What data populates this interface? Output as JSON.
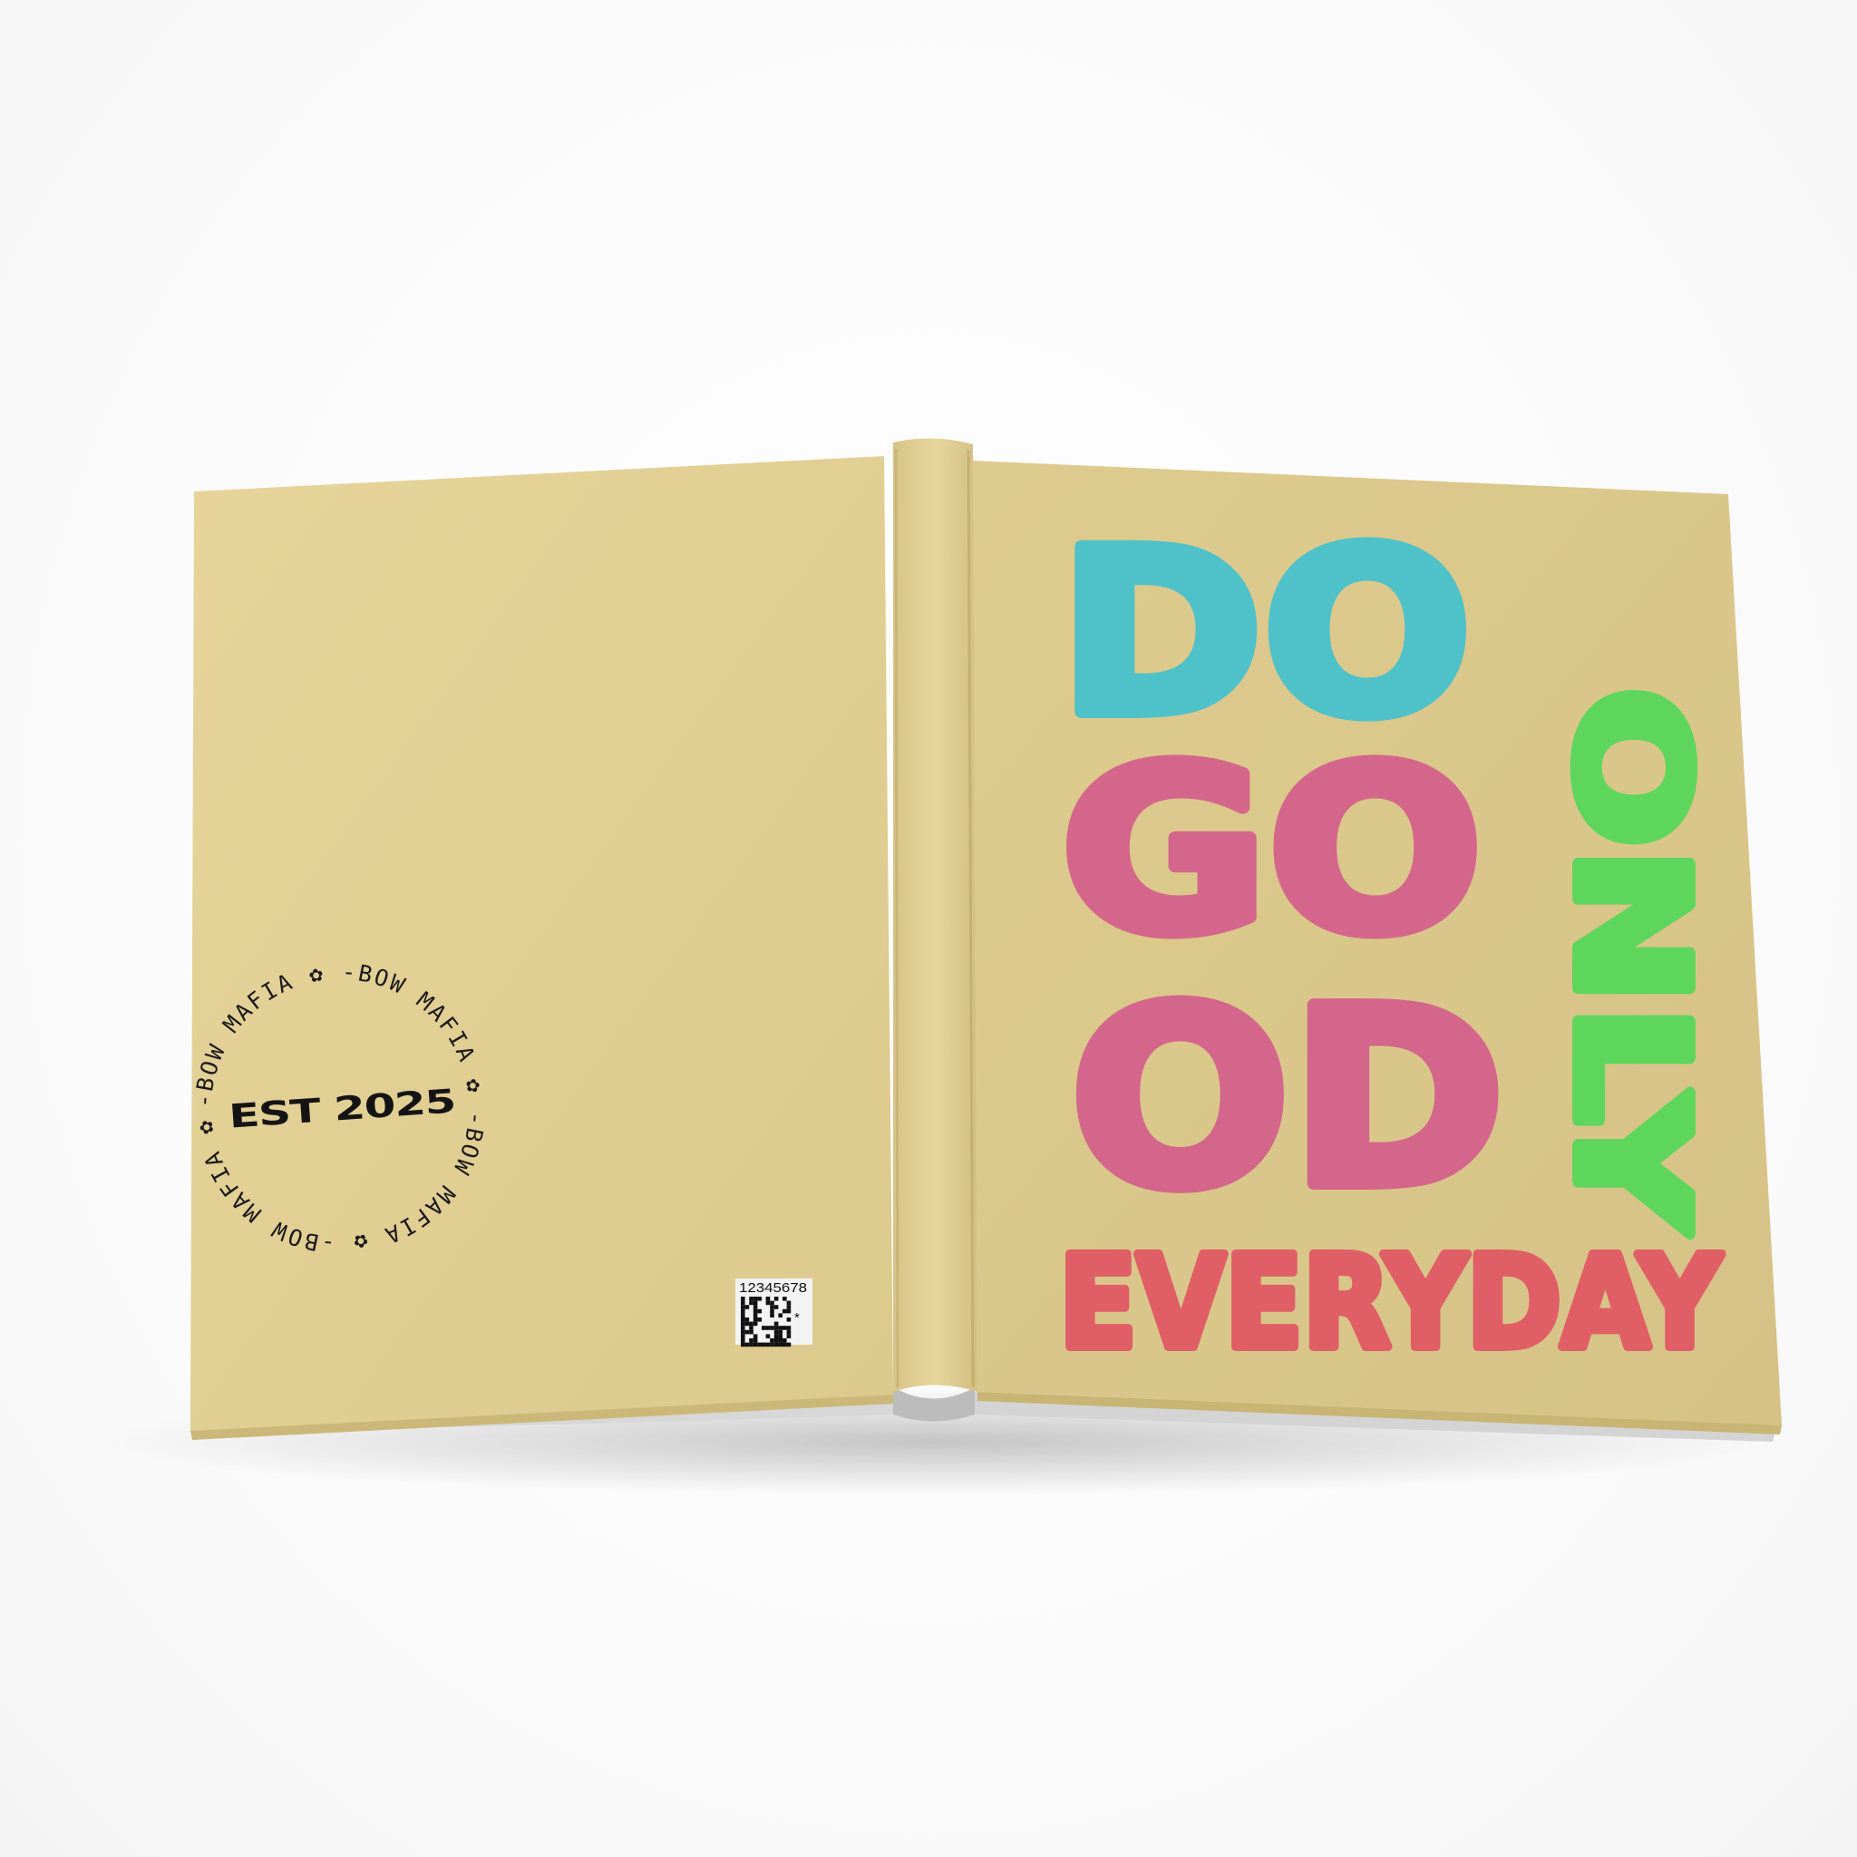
{
  "product": {
    "type": "hardcover journal",
    "cover_color": "#E3D096",
    "spine_color": "#E0CD92"
  },
  "front_cover": {
    "words": {
      "do": "DO",
      "go": "GO",
      "od": "OD",
      "only": "ONLY",
      "everyday": "EVERYDAY"
    },
    "colors": {
      "do": "#4FC1C8",
      "good": "#D4668B",
      "only": "#5ED65C",
      "everyday": "#E05E66"
    }
  },
  "back_cover": {
    "seal": {
      "ring_text": "-BOW MAFIA ✿ -BOW MAFIA ✿ -BOW MAFIA ✿ -BOW MAFIA ✿ ",
      "center_text": "EST 2025"
    },
    "barcode": {
      "number": "12345678",
      "mark": "*"
    }
  }
}
